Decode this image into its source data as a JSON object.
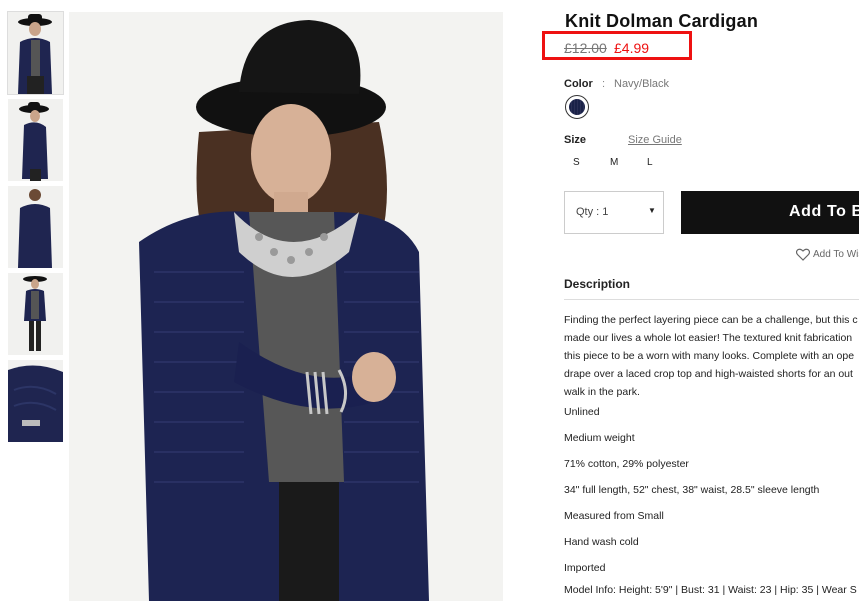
{
  "thumbnails": [
    {
      "alt": "front view"
    },
    {
      "alt": "side view"
    },
    {
      "alt": "back view"
    },
    {
      "alt": "full length view"
    },
    {
      "alt": "detail view"
    }
  ],
  "product": {
    "title": "Knit Dolman Cardigan",
    "price_old": "£12.00",
    "price_new": "£4.99"
  },
  "color": {
    "label": "Color",
    "colon": ":",
    "value": "Navy/Black"
  },
  "size": {
    "label": "Size",
    "guide": "Size Guide",
    "options": [
      "S",
      "M",
      "L"
    ]
  },
  "quantity": {
    "label": "Qty : 1",
    "caret": "▼"
  },
  "actions": {
    "add_to_bag": "Add To Bag",
    "wishlist": "Add To Wishlist"
  },
  "description": {
    "heading": "Description",
    "paragraph": [
      "Finding the perfect layering piece can be a challenge, but this c",
      "made our lives a whole lot easier! The textured knit fabrication",
      "this piece to be a worn with many looks. Complete with an ope",
      "drape over a laced crop top and high-waisted shorts for an out",
      "walk in the park."
    ],
    "details": [
      "Unlined",
      "Medium weight",
      "71% cotton, 29% polyester",
      "34\" full length, 52\" chest, 38\" waist, 28.5\" sleeve length",
      "Measured from Small",
      "Hand wash cold",
      "Imported",
      "Model Info: Height: 5'9\" | Bust: 31 | Waist: 23 | Hip: 35 | Wear S"
    ]
  },
  "colors": {
    "price_highlight": "#ee1111",
    "sale_price": "#ee1111",
    "button": "#111111",
    "swatch": "#1a2248"
  }
}
